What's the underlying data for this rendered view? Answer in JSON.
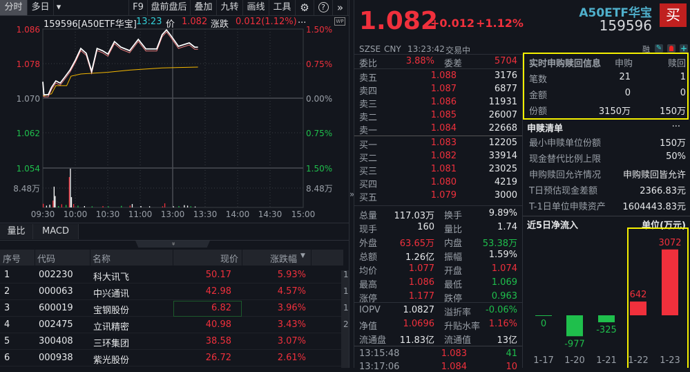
{
  "toolbar": {
    "tabs": [
      "分时",
      "多日"
    ],
    "dropdown_icon": "▾",
    "right": [
      "F9",
      "盘前盘后",
      "叠加",
      "九转",
      "画线",
      "工具"
    ],
    "gear_icon": "⚙",
    "help_icon": "?",
    "more_icon": "»"
  },
  "chart_info": {
    "code_name": "159596[A50ETF华宝]",
    "time": "13:23",
    "price_label": "价",
    "price": "1.082",
    "change_label": "涨跌",
    "change": "0.012(1.12%)",
    "ellipsis": "...",
    "wp": "WP"
  },
  "chart_data": {
    "type": "line",
    "title": "159596 A50ETF华宝 分时",
    "prev_close": 1.07,
    "ylim": [
      1.054,
      1.086
    ],
    "y_ticks_left": [
      "1.086",
      "1.078",
      "1.070",
      "1.062",
      "1.054"
    ],
    "y_ticks_right": [
      "1.50%",
      "0.75%",
      "0.00%",
      "0.75%",
      "1.50%"
    ],
    "volume_tick": "8.48万",
    "x_ticks": [
      "09:30",
      "10:00",
      "10:30",
      "11:00",
      "13:00",
      "13:30",
      "14:00",
      "14:30",
      "15:00"
    ],
    "price_series": [
      [
        0,
        1.0738
      ],
      [
        1,
        1.0708
      ],
      [
        5,
        1.0708
      ],
      [
        8,
        1.0725
      ],
      [
        12,
        1.074
      ],
      [
        16,
        1.0735
      ],
      [
        20,
        1.0748
      ],
      [
        25,
        1.0765
      ],
      [
        30,
        1.0788
      ],
      [
        35,
        1.0815
      ],
      [
        40,
        1.0804
      ],
      [
        45,
        1.0762
      ],
      [
        50,
        1.0815
      ],
      [
        55,
        1.081
      ],
      [
        60,
        1.0802
      ],
      [
        66,
        1.0831
      ],
      [
        72,
        1.0818
      ],
      [
        80,
        1.081
      ],
      [
        88,
        1.0836
      ],
      [
        95,
        1.0814
      ],
      [
        105,
        1.0814
      ],
      [
        110,
        1.0847
      ],
      [
        114,
        1.0858
      ],
      [
        118,
        1.0845
      ],
      [
        125,
        1.082
      ],
      [
        135,
        1.0828
      ],
      [
        140,
        1.0818
      ],
      [
        143,
        1.0818
      ]
    ],
    "avg_series": [
      [
        0,
        1.0705
      ],
      [
        8,
        1.071
      ],
      [
        12,
        1.0729
      ],
      [
        22,
        1.0729
      ],
      [
        26,
        1.0751
      ],
      [
        35,
        1.0756
      ],
      [
        60,
        1.076
      ],
      [
        80,
        1.0765
      ],
      [
        110,
        1.077
      ],
      [
        143,
        1.0772
      ]
    ],
    "volume_series": [
      [
        0,
        1.6,
        "r"
      ],
      [
        3,
        0.8,
        "w"
      ],
      [
        6,
        1.2,
        "w"
      ],
      [
        9,
        3.0,
        "r"
      ],
      [
        10,
        9.1,
        "w"
      ],
      [
        11,
        5.0,
        "w"
      ],
      [
        14,
        0.6,
        "g"
      ],
      [
        17,
        1.4,
        "r"
      ],
      [
        21,
        1.1,
        "g"
      ],
      [
        24,
        13.3,
        "r"
      ],
      [
        25,
        17.0,
        "w"
      ],
      [
        26,
        4.5,
        "w"
      ],
      [
        28,
        1.5,
        "r"
      ],
      [
        32,
        0.8,
        "g"
      ],
      [
        38,
        0.6,
        "w"
      ],
      [
        45,
        0.5,
        "g"
      ],
      [
        55,
        0.6,
        "r"
      ],
      [
        60,
        0.5,
        "g"
      ],
      [
        72,
        0.7,
        "g"
      ],
      [
        80,
        0.8,
        "r"
      ],
      [
        82,
        1.5,
        "w"
      ],
      [
        90,
        0.6,
        "w"
      ],
      [
        98,
        0.5,
        "w"
      ],
      [
        110,
        0.5,
        "r"
      ],
      [
        112,
        1.8,
        "r"
      ],
      [
        120,
        0.5,
        "w"
      ],
      [
        125,
        0.6,
        "g"
      ],
      [
        130,
        1.0,
        "w"
      ],
      [
        133,
        0.8,
        "w"
      ],
      [
        136,
        0.5,
        "g"
      ],
      [
        140,
        0.4,
        "w"
      ]
    ]
  },
  "bottom_tabs": [
    "量比",
    "MACD"
  ],
  "collapse_icon": "»",
  "table": {
    "headers": [
      "序号",
      "代码",
      "名称",
      "现价",
      "涨跌幅"
    ],
    "sort_icon": "▼",
    "rows": [
      [
        "1",
        "002230",
        "科大讯飞",
        "50.17",
        "5.93%"
      ],
      [
        "2",
        "000063",
        "中兴通讯",
        "42.98",
        "4.57%"
      ],
      [
        "3",
        "600019",
        "宝钢股份",
        "6.82",
        "3.96%"
      ],
      [
        "4",
        "002475",
        "立讯精密",
        "40.98",
        "3.43%"
      ],
      [
        "5",
        "300408",
        "三环集团",
        "38.58",
        "3.07%"
      ],
      [
        "6",
        "000938",
        "紫光股份",
        "26.72",
        "2.61%"
      ]
    ],
    "extra_col": [
      "1",
      "1",
      "1",
      "2"
    ]
  },
  "quote": {
    "price": "1.082",
    "change": "+0.012",
    "pct": "+1.12%",
    "name": "A50ETF华宝",
    "code": "159596",
    "buy": "买",
    "exchange": "SZSE",
    "currency": "CNY",
    "time": "13:23:42",
    "status": "交易中",
    "rong": "融"
  },
  "orderbook": {
    "weibi_label": "委比",
    "weibi": "3.88%",
    "weicha_label": "委差",
    "weicha": "5704",
    "asks": [
      [
        "卖五",
        "1.088",
        "3176"
      ],
      [
        "卖四",
        "1.087",
        "6877"
      ],
      [
        "卖三",
        "1.086",
        "11931"
      ],
      [
        "卖二",
        "1.085",
        "26007"
      ],
      [
        "卖一",
        "1.084",
        "22668"
      ]
    ],
    "bids": [
      [
        "买一",
        "1.083",
        "12205"
      ],
      [
        "买二",
        "1.082",
        "33914"
      ],
      [
        "买三",
        "1.081",
        "23025"
      ],
      [
        "买四",
        "1.080",
        "4219"
      ],
      [
        "买五",
        "1.079",
        "3000"
      ]
    ]
  },
  "stats": [
    [
      "总量",
      "117.03万",
      "w",
      "换手",
      "9.89%",
      "w"
    ],
    [
      "现手",
      "160",
      "w",
      "量比",
      "1.74",
      "w"
    ],
    [
      "外盘",
      "63.65万",
      "r",
      "内盘",
      "53.38万",
      "g"
    ],
    [
      "总额",
      "1.26亿",
      "w",
      "振幅",
      "1.59%",
      "w"
    ],
    [
      "均价",
      "1.077",
      "r",
      "开盘",
      "1.074",
      "r"
    ],
    [
      "最高",
      "1.086",
      "r",
      "最低",
      "1.069",
      "g"
    ],
    [
      "涨停",
      "1.177",
      "r",
      "跌停",
      "0.963",
      "g"
    ]
  ],
  "fund": [
    [
      "IOPV",
      "1.0827",
      "w",
      "溢折率",
      "-0.06%",
      "g"
    ],
    [
      "净值",
      "1.0696",
      "r",
      "升贴水率",
      "1.16%",
      "r"
    ],
    [
      "流通盘",
      "11.83亿",
      "w",
      "流通值",
      "13亿",
      "w"
    ]
  ],
  "trades": [
    [
      "13:15:48",
      "1.083",
      "41"
    ],
    [
      "13:17:06",
      "1.084",
      "10"
    ]
  ],
  "subscription": {
    "title": "实时申购赎回信息",
    "col1": "申购",
    "col2": "赎回",
    "rows": [
      [
        "笔数",
        "21",
        "1"
      ],
      [
        "金额",
        "0",
        "0"
      ],
      [
        "份额",
        "3150万",
        "150万"
      ]
    ]
  },
  "list": {
    "title": "申赎清单",
    "more": "...",
    "rows": [
      [
        "最小申赎单位份额",
        "150万"
      ],
      [
        "现金替代比例上限",
        "50%"
      ],
      [
        "申购赎回允许情况",
        "申购赎回皆允许"
      ],
      [
        "T日预估现金差额",
        "2366.83元"
      ],
      [
        "T-1日单位申赎资产",
        "1604443.83元"
      ]
    ]
  },
  "netflow": {
    "title": "近5日净流入",
    "unit": "单位(万元)",
    "dates": [
      "1-17",
      "1-20",
      "1-21",
      "1-22",
      "1-23"
    ],
    "values": [
      0,
      -977,
      -325,
      642,
      3072
    ],
    "up_color": "#f0303c",
    "down_color": "#1fbf4c"
  }
}
